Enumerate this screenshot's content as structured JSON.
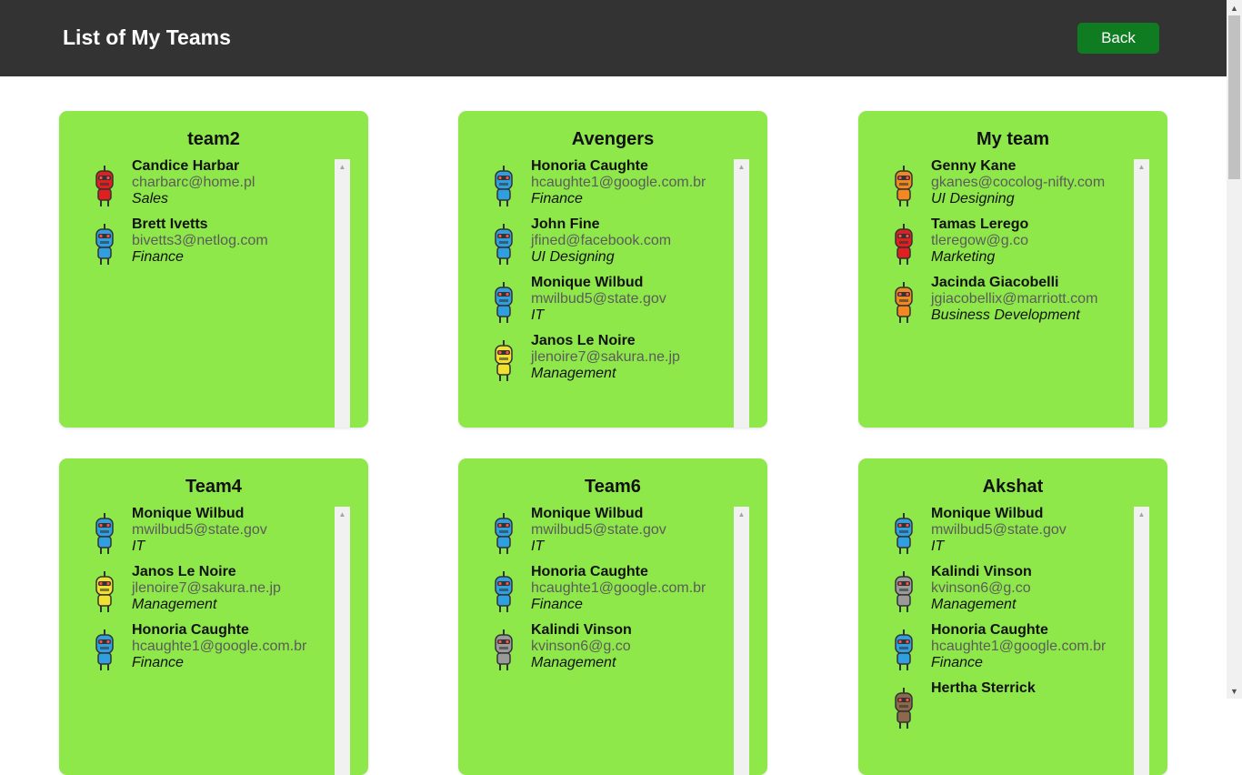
{
  "header": {
    "title": "List of My Teams",
    "back_label": "Back"
  },
  "teams": [
    {
      "name": "team2",
      "members": [
        {
          "name": "Candice Harbar",
          "email": "charbarc@home.pl",
          "dept": "Sales",
          "avatar_color": "#e02020",
          "avatar": "red-robot-icon"
        },
        {
          "name": "Brett Ivetts",
          "email": "bivetts3@netlog.com",
          "dept": "Finance",
          "avatar_color": "#2f9fe0",
          "avatar": "blue-robot-icon"
        }
      ]
    },
    {
      "name": "Avengers",
      "members": [
        {
          "name": "Honoria Caughte",
          "email": "hcaughte1@google.com.br",
          "dept": "Finance",
          "avatar_color": "#2f9fe0",
          "avatar": "blue-robot-icon"
        },
        {
          "name": "John Fine",
          "email": "jfined@facebook.com",
          "dept": "UI Designing",
          "avatar_color": "#2f9fe0",
          "avatar": "blue-robot-icon"
        },
        {
          "name": "Monique Wilbud",
          "email": "mwilbud5@state.gov",
          "dept": "IT",
          "avatar_color": "#2f9fe0",
          "avatar": "blue-robot-icon"
        },
        {
          "name": "Janos Le Noire",
          "email": "jlenoire7@sakura.ne.jp",
          "dept": "Management",
          "avatar_color": "#f0e030",
          "avatar": "yellow-robot-icon"
        }
      ]
    },
    {
      "name": "My team",
      "members": [
        {
          "name": "Genny Kane",
          "email": "gkanes@cocolog-nifty.com",
          "dept": "UI Designing",
          "avatar_color": "#f08a20",
          "avatar": "orange-robot-icon"
        },
        {
          "name": "Tamas Lerego",
          "email": "tleregow@g.co",
          "dept": "Marketing",
          "avatar_color": "#e02020",
          "avatar": "red-robot-icon"
        },
        {
          "name": "Jacinda Giacobelli",
          "email": "jgiacobellix@marriott.com",
          "dept": "Business Development",
          "avatar_color": "#f08a20",
          "avatar": "orange-robot-icon"
        }
      ]
    },
    {
      "name": "Team4",
      "members": [
        {
          "name": "Monique Wilbud",
          "email": "mwilbud5@state.gov",
          "dept": "IT",
          "avatar_color": "#2f9fe0",
          "avatar": "blue-robot-icon"
        },
        {
          "name": "Janos Le Noire",
          "email": "jlenoire7@sakura.ne.jp",
          "dept": "Management",
          "avatar_color": "#f0e030",
          "avatar": "yellow-robot-icon"
        },
        {
          "name": "Honoria Caughte",
          "email": "hcaughte1@google.com.br",
          "dept": "Finance",
          "avatar_color": "#2f9fe0",
          "avatar": "blue-robot-icon"
        }
      ]
    },
    {
      "name": "Team6",
      "members": [
        {
          "name": "Monique Wilbud",
          "email": "mwilbud5@state.gov",
          "dept": "IT",
          "avatar_color": "#2f9fe0",
          "avatar": "blue-robot-icon"
        },
        {
          "name": "Honoria Caughte",
          "email": "hcaughte1@google.com.br",
          "dept": "Finance",
          "avatar_color": "#2f9fe0",
          "avatar": "blue-robot-icon"
        },
        {
          "name": "Kalindi Vinson",
          "email": "kvinson6@g.co",
          "dept": "Management",
          "avatar_color": "#9a9a9a",
          "avatar": "grey-robot-icon"
        }
      ]
    },
    {
      "name": "Akshat",
      "members": [
        {
          "name": "Monique Wilbud",
          "email": "mwilbud5@state.gov",
          "dept": "IT",
          "avatar_color": "#2f9fe0",
          "avatar": "blue-robot-icon"
        },
        {
          "name": "Kalindi Vinson",
          "email": "kvinson6@g.co",
          "dept": "Management",
          "avatar_color": "#9a9a9a",
          "avatar": "grey-robot-icon"
        },
        {
          "name": "Honoria Caughte",
          "email": "hcaughte1@google.com.br",
          "dept": "Finance",
          "avatar_color": "#2f9fe0",
          "avatar": "blue-robot-icon"
        },
        {
          "name": "Hertha Sterrick",
          "email": "",
          "dept": "",
          "avatar_color": "#8a6a4a",
          "avatar": "brown-robot-icon"
        }
      ]
    }
  ]
}
